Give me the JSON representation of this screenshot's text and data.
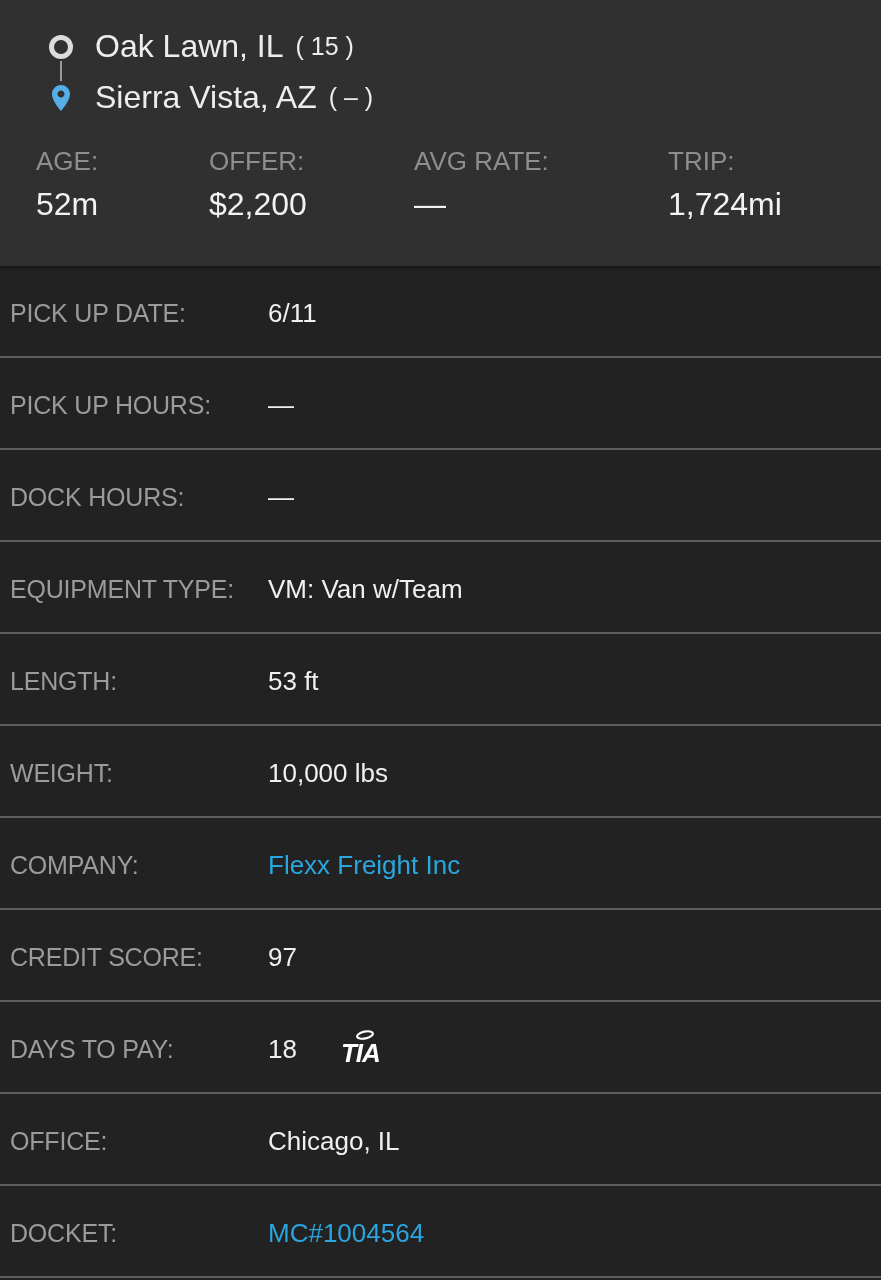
{
  "route": {
    "origin": {
      "city": "Oak Lawn, IL",
      "count": "( 15 )"
    },
    "destination": {
      "city": "Sierra Vista, AZ",
      "count": "( – )"
    }
  },
  "stats": [
    {
      "label": "AGE:",
      "value": "52m"
    },
    {
      "label": "OFFER:",
      "value": "$2,200"
    },
    {
      "label": "AVG RATE:",
      "value": "—"
    },
    {
      "label": "TRIP:",
      "value": "1,724mi"
    }
  ],
  "details": [
    {
      "label": "PICK UP DATE:",
      "value": "6/11",
      "kind": "text"
    },
    {
      "label": "PICK UP HOURS:",
      "value": "—",
      "kind": "text"
    },
    {
      "label": "DOCK HOURS:",
      "value": "—",
      "kind": "text"
    },
    {
      "label": "EQUIPMENT TYPE:",
      "value": "VM: Van w/Team",
      "kind": "text"
    },
    {
      "label": "LENGTH:",
      "value": "53 ft",
      "kind": "text"
    },
    {
      "label": "WEIGHT:",
      "value": "10,000 lbs",
      "kind": "text"
    },
    {
      "label": "COMPANY:",
      "value": "Flexx Freight Inc",
      "kind": "link"
    },
    {
      "label": "CREDIT SCORE:",
      "value": "97",
      "kind": "text"
    },
    {
      "label": "DAYS TO PAY:",
      "value": "18",
      "kind": "text",
      "badge": "TIA"
    },
    {
      "label": "OFFICE:",
      "value": "Chicago, IL",
      "kind": "text"
    },
    {
      "label": "DOCKET:",
      "value": "MC#1004564",
      "kind": "link"
    }
  ]
}
